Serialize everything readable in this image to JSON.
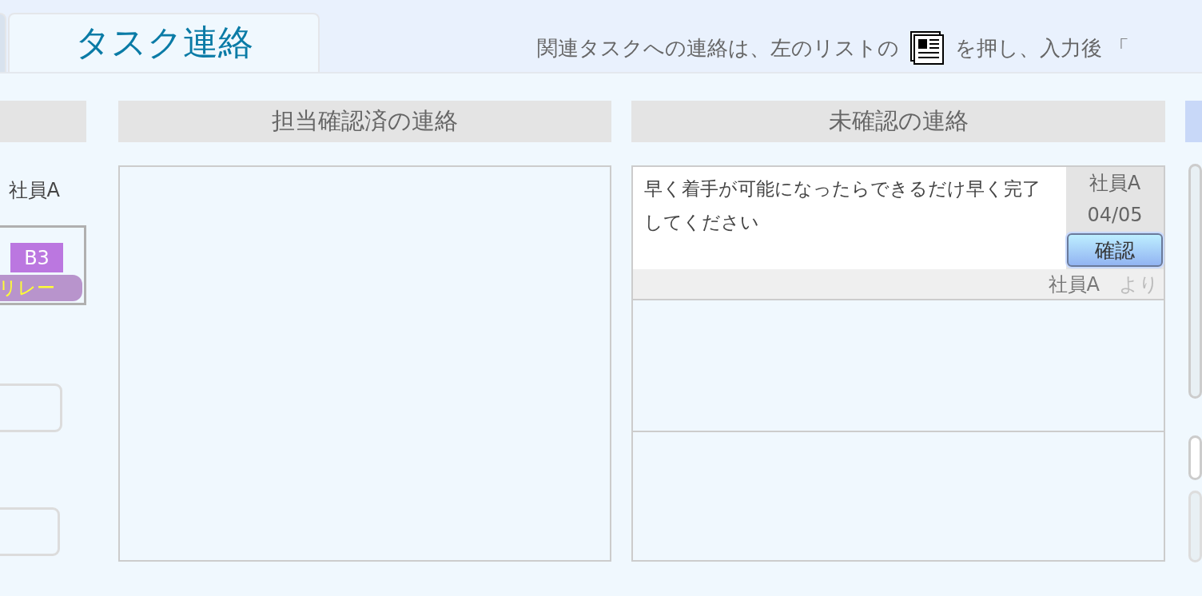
{
  "tabs": [
    {
      "label": "タスク連絡",
      "selected": true
    }
  ],
  "hint": {
    "before": "関連タスクへの連絡は、左のリストの",
    "after": "を押し、入力後 「"
  },
  "left_panel": {
    "assignee": "社員A",
    "task_card": {
      "badge": "B3",
      "tag": "リレー"
    }
  },
  "confirmed_messages": {
    "title": "担当確認済の連絡"
  },
  "unconfirmed_messages": {
    "title": "未確認の連絡",
    "messages": [
      {
        "text": "早く着手が可能になったらできるだけ早く完了してください",
        "author": "社員A",
        "date": "04/05",
        "button": "確認",
        "from": "社員A",
        "from_suffix": "より"
      }
    ]
  }
}
